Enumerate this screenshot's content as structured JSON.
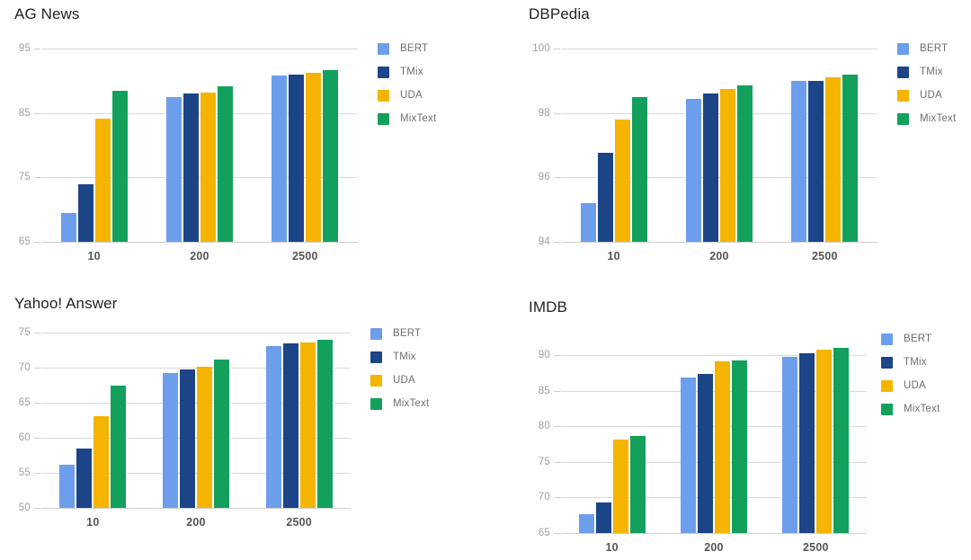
{
  "figure": {
    "panels": [
      "ag_news",
      "dbpedia",
      "yahoo",
      "imdb"
    ]
  },
  "series_colors": {
    "BERT": "#6D9EEB",
    "TMix": "#1C4587",
    "UDA": "#F5B400",
    "MixText": "#13A05C"
  },
  "legend": {
    "entries": [
      {
        "label": "BERT",
        "color": "#6D9EEB"
      },
      {
        "label": "TMix",
        "color": "#1C4587"
      },
      {
        "label": "UDA",
        "color": "#F5B400"
      },
      {
        "label": "MixText",
        "color": "#13A05C"
      }
    ]
  },
  "chart_data": [
    {
      "id": "ag_news",
      "type": "bar",
      "title": "AG News",
      "xlabel": "",
      "ylabel": "",
      "categories": [
        "10",
        "200",
        "2500"
      ],
      "ylim": [
        65,
        95
      ],
      "yticks": [
        65,
        75,
        85,
        95
      ],
      "grid": true,
      "legend_position": "right",
      "series": [
        {
          "name": "BERT",
          "color": "#6D9EEB",
          "values": [
            69.4,
            87.5,
            90.8
          ]
        },
        {
          "name": "TMix",
          "color": "#1C4587",
          "values": [
            73.9,
            88.0,
            91.0
          ]
        },
        {
          "name": "UDA",
          "color": "#F5B400",
          "values": [
            84.1,
            88.1,
            91.2
          ]
        },
        {
          "name": "MixText",
          "color": "#13A05C",
          "values": [
            88.4,
            89.2,
            91.7
          ]
        }
      ]
    },
    {
      "id": "dbpedia",
      "type": "bar",
      "title": "DBPedia",
      "xlabel": "",
      "ylabel": "",
      "categories": [
        "10",
        "200",
        "2500"
      ],
      "ylim": [
        94,
        100
      ],
      "yticks": [
        94,
        96,
        98,
        100
      ],
      "grid": true,
      "legend_position": "right",
      "series": [
        {
          "name": "BERT",
          "color": "#6D9EEB",
          "values": [
            95.2,
            98.45,
            99.0
          ]
        },
        {
          "name": "TMix",
          "color": "#1C4587",
          "values": [
            96.75,
            98.6,
            99.0
          ]
        },
        {
          "name": "UDA",
          "color": "#F5B400",
          "values": [
            97.8,
            98.75,
            99.1
          ]
        },
        {
          "name": "MixText",
          "color": "#13A05C",
          "values": [
            98.5,
            98.85,
            99.2
          ]
        }
      ]
    },
    {
      "id": "yahoo",
      "type": "bar",
      "title": "Yahoo! Answer",
      "xlabel": "",
      "ylabel": "",
      "categories": [
        "10",
        "200",
        "2500"
      ],
      "ylim": [
        50,
        75
      ],
      "yticks": [
        50,
        55,
        60,
        65,
        70,
        75
      ],
      "grid": true,
      "legend_position": "right",
      "series": [
        {
          "name": "BERT",
          "color": "#6D9EEB",
          "values": [
            56.2,
            69.2,
            73.1
          ]
        },
        {
          "name": "TMix",
          "color": "#1C4587",
          "values": [
            58.5,
            69.7,
            73.4
          ]
        },
        {
          "name": "UDA",
          "color": "#F5B400",
          "values": [
            63.1,
            70.1,
            73.6
          ]
        },
        {
          "name": "MixText",
          "color": "#13A05C",
          "values": [
            67.5,
            71.1,
            74.0
          ]
        }
      ]
    },
    {
      "id": "imdb",
      "type": "bar",
      "title": "IMDB",
      "xlabel": "",
      "ylabel": "",
      "categories": [
        "10",
        "200",
        "2500"
      ],
      "ylim": [
        65,
        90
      ],
      "yticks": [
        65,
        70,
        75,
        80,
        85,
        90
      ],
      "grid": true,
      "legend_position": "right",
      "series": [
        {
          "name": "BERT",
          "color": "#6D9EEB",
          "values": [
            67.6,
            86.9,
            89.8
          ]
        },
        {
          "name": "TMix",
          "color": "#1C4587",
          "values": [
            69.3,
            87.4,
            90.3
          ]
        },
        {
          "name": "UDA",
          "color": "#F5B400",
          "values": [
            78.1,
            89.1,
            90.8
          ]
        },
        {
          "name": "MixText",
          "color": "#13A05C",
          "values": [
            78.7,
            89.3,
            91.0
          ]
        }
      ]
    }
  ]
}
